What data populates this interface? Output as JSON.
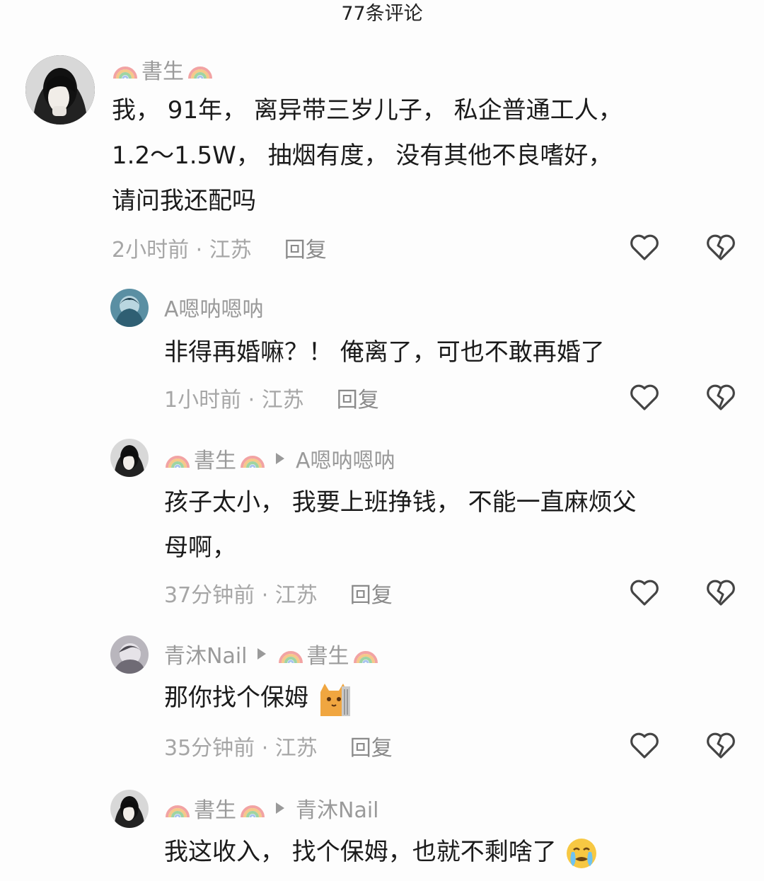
{
  "header": {
    "title": "77条评论"
  },
  "comments": [
    {
      "author": "書生",
      "reply_to": "",
      "lines": [
        "我，  91年，   离异带三岁儿子，     私企普通工人，",
        "1.2～1.5W，    抽烟有度，   没有其他不良嗜好，",
        "请问我还配吗"
      ],
      "time": "2小时前 · 江苏",
      "reply_label": "回复",
      "avatar_icon": "portrait-avatar"
    },
    {
      "author": "A嗯呐嗯呐",
      "reply_to": "",
      "lines": [
        "非得再婚嘛？！ 俺离了，可也不敢再婚了"
      ],
      "time": "1小时前 · 江苏",
      "reply_label": "回复",
      "avatar_icon": "anime-avatar"
    },
    {
      "author": "書生",
      "reply_to": "A嗯呐嗯呐",
      "lines": [
        "孩子太小，   我要上班挣钱，   不能一直麻烦父",
        "母啊，"
      ],
      "time": "37分钟前 · 江苏",
      "reply_label": "回复",
      "avatar_icon": "portrait-avatar"
    },
    {
      "author": "青沐Nail",
      "reply_to": "書生",
      "lines": [
        "那你找个保姆"
      ],
      "time": "35分钟前 · 江苏",
      "reply_label": "回复",
      "avatar_icon": "grey-avatar",
      "trailing_emoji": "cat-emoji"
    },
    {
      "author": "書生",
      "reply_to": "青沐Nail",
      "lines": [
        "我这收入，   找个保姆，也就不剩啥了"
      ],
      "time": "",
      "reply_label": "",
      "avatar_icon": "portrait-avatar",
      "trailing_emoji": "crying-emoji"
    }
  ],
  "icons": {
    "like": "heart-outline-icon",
    "dislike": "broken-heart-icon",
    "rainbow": "rainbow-emoji"
  },
  "colors": {
    "text": "#1b1b1b",
    "muted": "#9a9a9a",
    "icon": "#444444",
    "background": "#fdfdfd"
  }
}
